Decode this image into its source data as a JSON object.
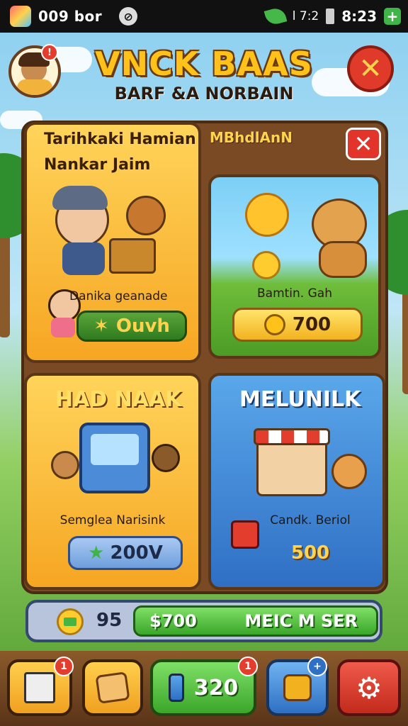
{
  "status_bar": {
    "carrier": "009 bor",
    "signal_text": "l 7:2",
    "time": "8:23",
    "icons": [
      "app-icon",
      "no-disturb-icon",
      "leaf-icon",
      "battery-icon",
      "plus-icon"
    ]
  },
  "header": {
    "title": "VNCK BAAS",
    "subtitle": "BARF &A NORBAIN",
    "avatar_badge": "!",
    "close_icon": "close-icon"
  },
  "cards": [
    {
      "heading_line1": "Tarihkaki Hamian",
      "heading_line2": "Nankar Jaim",
      "label": "Danika geanade",
      "button_label": "Ouvh",
      "button_icon": "star-icon"
    },
    {
      "heading": "MBhdlAnN",
      "label": "Bamtin. Gah",
      "price": "700",
      "price_icon": "coin-icon"
    },
    {
      "heading": "HAD NAAK",
      "label": "Semglea Narisink",
      "price": "200V",
      "price_icon": "star-icon"
    },
    {
      "heading": "MELUNILK",
      "label": "Candk. Beriol",
      "price": "500"
    }
  ],
  "progress": {
    "count": "95",
    "price": "$700",
    "action_label": "MEIC M SER"
  },
  "dock": {
    "items": [
      {
        "icon": "box-icon",
        "badge": "1"
      },
      {
        "icon": "map-icon"
      },
      {
        "icon": "can-icon",
        "label": "320",
        "badge": "1"
      },
      {
        "icon": "gift-icon",
        "badge": "+"
      },
      {
        "icon": "gear-icon"
      }
    ]
  },
  "colors": {
    "title": "#ffc21a",
    "close": "#e03a2b",
    "green_button": "#3aa62a",
    "blue_card": "#2f6fc4",
    "orange_card": "#f6a623"
  }
}
